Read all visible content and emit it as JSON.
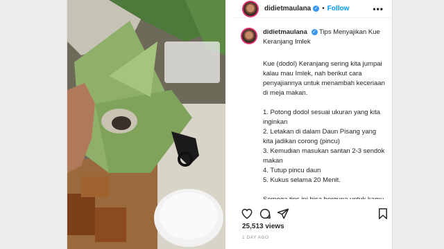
{
  "post": {
    "username": "didietmaulana",
    "follow_label": "Follow",
    "more_label": "•••",
    "caption_title": "Tips Menyajikan Kue Keranjang Imlek",
    "caption_body": "Kue (dodol) Keranjang sering kita jumpai kalau mau Imlek, nah berikut cara penyajiannya untuk menambah keceriaan di meja makan.\n\n1. Potong dodol sesuai ukuran yang kita inginkan\n2. Letakan di dalam Daun Pisang yang kita jadikan corong (pincu)\n3. Kemudian masukan santan 2-3 sendok makan\n4. Tutup pincu daun\n5. Kukus selama 20 Menit.\n\nSemoga tips ini bisa berguna untuk kamu yang ingin menikmati sajian Kue Dodol Keranjang.",
    "views": "25,513 views",
    "timestamp": "1 DAY AGO"
  },
  "icons": {
    "like": "heart-icon",
    "comment": "comment-icon",
    "share": "share-icon",
    "save": "bookmark-icon",
    "verified": "verified-badge-icon"
  },
  "colors": {
    "accent": "#0095f6",
    "verified": "#3897f0",
    "text": "#262626",
    "muted": "#8e8e8e"
  }
}
